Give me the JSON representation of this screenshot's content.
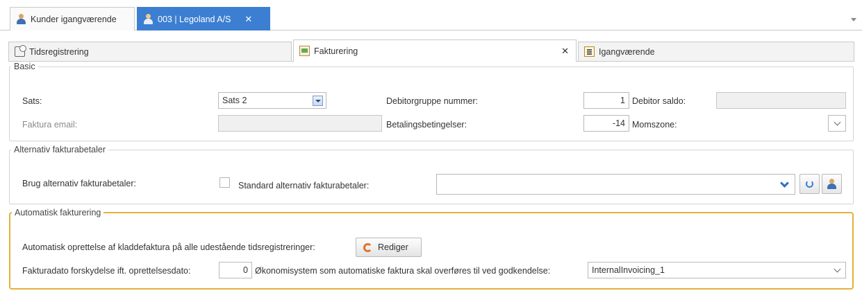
{
  "doc_tabs": [
    {
      "label": "Kunder igangværende",
      "icon": "person-icon",
      "active": false
    },
    {
      "label": "003 | Legoland A/S",
      "icon": "person-icon",
      "active": true,
      "close": "✕"
    }
  ],
  "sub_tabs": [
    {
      "label": "Tidsregistrering",
      "icon": "clock-calendar-icon"
    },
    {
      "label": "Fakturering",
      "icon": "invoice-icon",
      "active": true,
      "close": "✕"
    },
    {
      "label": "Igangværende",
      "icon": "pending-list-icon"
    }
  ],
  "basic": {
    "legend": "Basic",
    "sats_label": "Sats:",
    "sats_value": "Sats 2",
    "faktura_email_label": "Faktura email:",
    "debitorgruppe_label": "Debitorgruppe nummer:",
    "debitorgruppe_value": "1",
    "betalingsbetingelser_label": "Betalingsbetingelser:",
    "betalingsbetingelser_value": "-14",
    "debitor_saldo_label": "Debitor saldo:",
    "momszone_label": "Momszone:"
  },
  "alt": {
    "legend": "Alternativ fakturabetaler",
    "brug_label": "Brug alternativ fakturabetaler:",
    "standard_label": "Standard alternativ fakturabetaler:"
  },
  "auto": {
    "legend": "Automatisk fakturering",
    "oprettelse_label": "Automatisk oprettelse af kladdefaktura på alle udestående tidsregistreringer:",
    "rediger_label": "Rediger",
    "forskydelse_label": "Fakturadato forskydelse ift. oprettelsesdato:",
    "forskydelse_value": "0",
    "okonomi_label": "Økonomisystem som automatiske faktura skal overføres til ved godkendelse:",
    "okonomi_value": "InternalInvoicing_1"
  },
  "colors": {
    "active_tab": "#3c7ed1",
    "highlight_border": "#e4b13a"
  }
}
